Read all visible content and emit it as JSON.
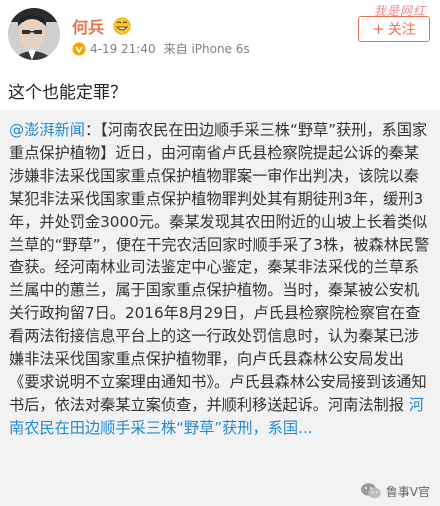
{
  "post": {
    "username": "何兵",
    "time": "4-19 21:40",
    "source": "来自 iPhone 6s",
    "watermark": "我是网红",
    "follow_label": "关注",
    "text": "这个也能定罪？"
  },
  "repost": {
    "mention": "@澎湃新闻",
    "colon": "：",
    "body": "【河南农民在田边顺手采三株“野草”获刑，系国家重点保护植物】近日，由河南省卢氏县检察院提起公诉的秦某涉嫌非法采伐国家重点保护植物罪案一审作出判决，该院以秦某犯非法采伐国家重点保护植物罪判处其有期徒刑3年，缓刑3年，并处罚金3000元。秦某发现其农田附近的山坡上长着类似兰草的“野草”，便在干完农活回家时顺手采了3株，被森林民警查获。经河南林业司法鉴定中心鉴定，秦某非法采伐的兰草系兰属中的蕙兰，属于国家重点保护植物。当时，秦某被公安机关行政拘留7日。2016年8月29日，卢氏县检察院检察官在查看两法衔接信息平台上的这一行政处罚信息时，认为秦某已涉嫌非法采伐国家重点保护植物罪，向卢氏县森林公安局发出《要求说明不立案理由通知书》。卢氏县森林公安局接到该通知书后，依法对秦某立案侦查，并顺利移送起诉。河南法制报 ",
    "topic": "河南农民在田边顺手采三株“野草”获刑，系国..."
  },
  "footer": {
    "label": "鲁事V官"
  },
  "colors": {
    "accent": "#eb7350",
    "link": "#1e8ad6",
    "repost_bg": "#f2f2f2"
  },
  "icons": [
    "avatar",
    "grin-emoji-icon",
    "vip-icon",
    "wechat-icon"
  ]
}
